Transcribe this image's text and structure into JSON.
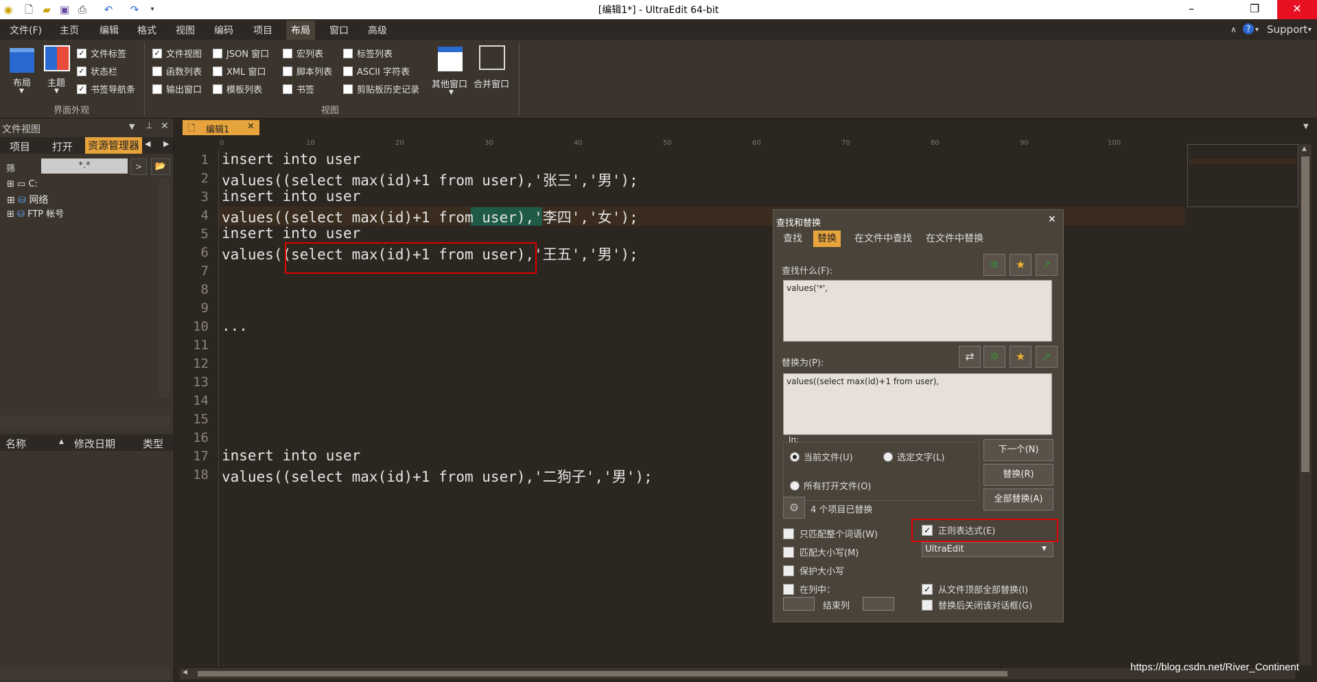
{
  "window": {
    "title": "[编辑1*] - UltraEdit 64-bit",
    "minimize": "–",
    "restore": "❐",
    "close": "✕"
  },
  "quick_access": [
    "new-file-icon",
    "open-folder-icon",
    "save-icon",
    "print-icon",
    "undo-icon",
    "redo-icon"
  ],
  "menu": [
    "文件(F)",
    "主页",
    "编辑",
    "格式",
    "视图",
    "编码",
    "项目",
    "布局",
    "窗口",
    "高级"
  ],
  "menu_active": "布局",
  "help": {
    "support": "Support",
    "help_glyph": "?"
  },
  "ribbon": {
    "layout_label": "布局",
    "theme_label": "主题",
    "group1_label": "界面外观",
    "group2_label": "视图",
    "other_windows": "其他窗口",
    "merge_windows": "合并窗口",
    "group1_checks": [
      {
        "label": "文件标签",
        "checked": true
      },
      {
        "label": "状态栏",
        "checked": true
      },
      {
        "label": "书签导航条",
        "checked": true
      }
    ],
    "view_checks": [
      {
        "label": "文件视图",
        "checked": true
      },
      {
        "label": "函数列表",
        "checked": false
      },
      {
        "label": "输出窗口",
        "checked": false
      },
      {
        "label": "JSON 窗口",
        "checked": false
      },
      {
        "label": "XML 窗口",
        "checked": false
      },
      {
        "label": "模板列表",
        "checked": false
      },
      {
        "label": "宏列表",
        "checked": false
      },
      {
        "label": "脚本列表",
        "checked": false
      },
      {
        "label": "书签",
        "checked": false
      },
      {
        "label": "标签列表",
        "checked": false
      },
      {
        "label": "ASCII 字符表",
        "checked": false
      },
      {
        "label": "剪贴板历史记录",
        "checked": false
      }
    ]
  },
  "file_panel": {
    "title": "文件视图",
    "tabs": [
      "项目",
      "打开",
      "资源管理器"
    ],
    "filter_label": "筛",
    "filter_value": "*.*",
    "tree": [
      "C:",
      "网络",
      "FTP 帐号"
    ],
    "columns": [
      "名称",
      "修改日期",
      "类型"
    ]
  },
  "editor": {
    "tab": "编辑1",
    "ruler": [
      "0",
      "10",
      "20",
      "30",
      "40",
      "50",
      "60",
      "70",
      "80",
      "90",
      "100"
    ],
    "lines": [
      {
        "n": "1",
        "text": "insert into user"
      },
      {
        "n": "2",
        "text": "values((select max(id)+1 from user),'张三','男');"
      },
      {
        "n": "3",
        "text": "insert into user"
      },
      {
        "n": "4",
        "text": "values((select max(id)+1 from user),'李四','女');"
      },
      {
        "n": "5",
        "text": "insert into user"
      },
      {
        "n": "6",
        "text": "values((select max(id)+1 from user),'王五','男');"
      },
      {
        "n": "7",
        "text": ""
      },
      {
        "n": "8",
        "text": ""
      },
      {
        "n": "9",
        "text": ""
      },
      {
        "n": "10",
        "text": "..."
      },
      {
        "n": "11",
        "text": ""
      },
      {
        "n": "12",
        "text": ""
      },
      {
        "n": "13",
        "text": ""
      },
      {
        "n": "14",
        "text": ""
      },
      {
        "n": "15",
        "text": ""
      },
      {
        "n": "16",
        "text": ""
      },
      {
        "n": "17",
        "text": "insert into user"
      },
      {
        "n": "18",
        "text": "values((select max(id)+1 from user),'二狗子','男');"
      }
    ]
  },
  "dialog": {
    "title": "查找和替换",
    "tabs": [
      "查找",
      "替换",
      "在文件中查找",
      "在文件中替换"
    ],
    "active_tab": "替换",
    "find_label": "查找什么(F):",
    "find_value": "values('*',",
    "replace_label": "替换为(P):",
    "replace_value": "values((select max(id)+1 from user),",
    "in_label": "In:",
    "scope": [
      {
        "label": "当前文件(U)",
        "selected": true
      },
      {
        "label": "选定文字(L)",
        "selected": false
      },
      {
        "label": "所有打开文件(O)",
        "selected": false
      }
    ],
    "buttons": [
      "下一个(N)",
      "替换(R)",
      "全部替换(A)"
    ],
    "status": "4 个项目已替换",
    "left_options": [
      {
        "label": "只匹配整个词语(W)",
        "checked": false
      },
      {
        "label": "匹配大小写(M)",
        "checked": false
      },
      {
        "label": "保护大小写",
        "checked": false
      },
      {
        "label": "在列中：",
        "checked": false
      }
    ],
    "end_col_label": "结束列",
    "regex": {
      "label": "正则表达式(E)",
      "checked": true
    },
    "regex_engine": "UltraEdit",
    "right_options": [
      {
        "label": "从文件顶部全部替换(I)",
        "checked": true
      },
      {
        "label": "替换后关闭该对话框(G)",
        "checked": false
      }
    ]
  },
  "watermark": "https://blog.csdn.net/River_Continent",
  "colors": {
    "accent": "#e8a43c",
    "highlight": "#e00000",
    "background": "#2b2620"
  }
}
